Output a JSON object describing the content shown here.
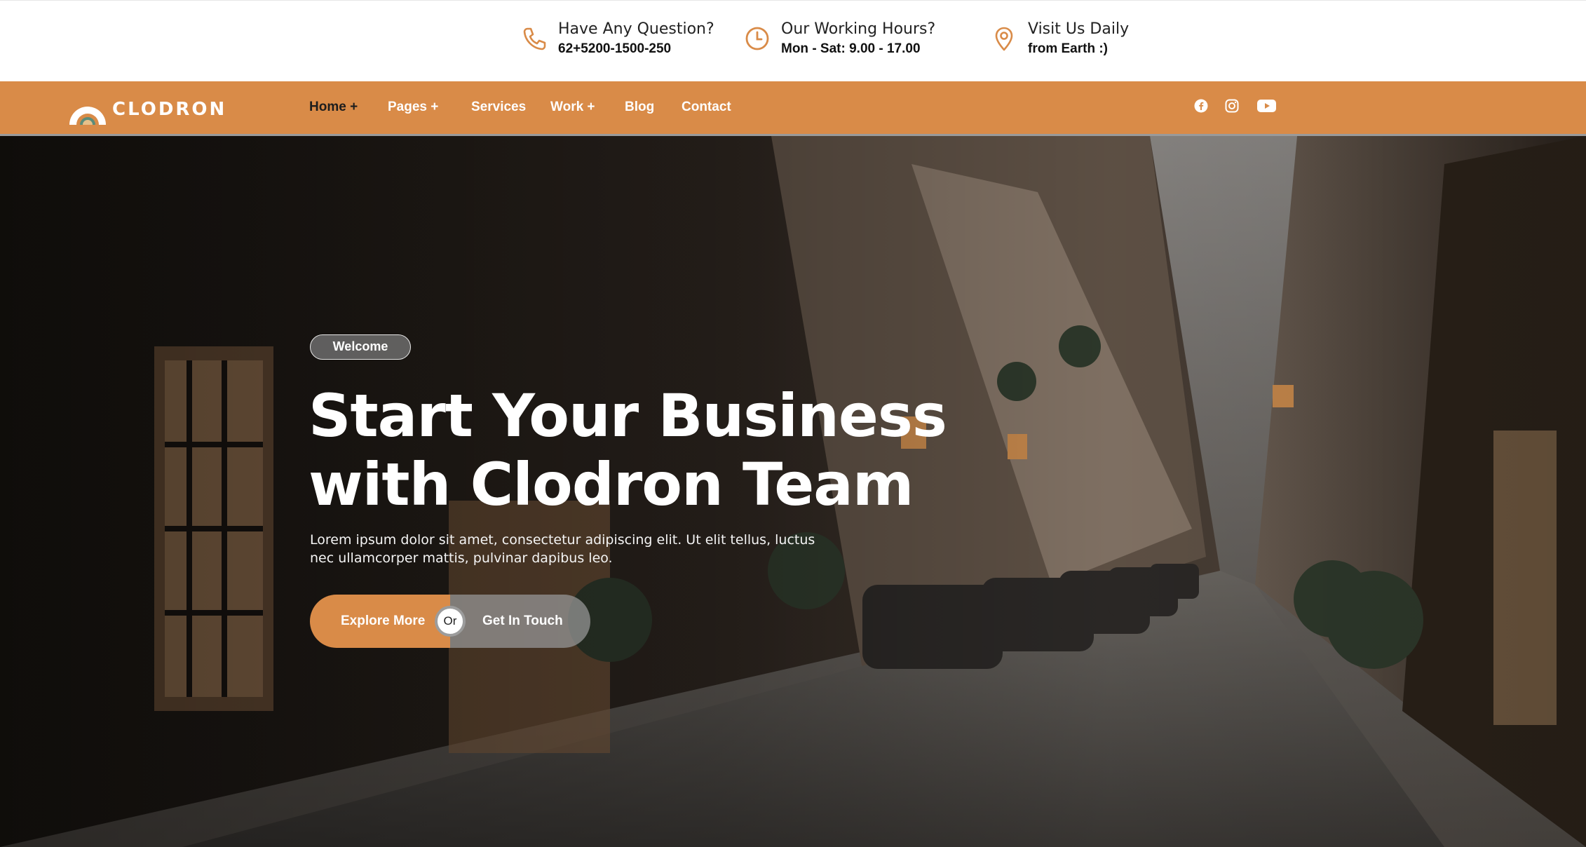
{
  "topbar": {
    "items": [
      {
        "label": "Have Any Question?",
        "value": "62+5200-1500-250",
        "icon": "phone-icon"
      },
      {
        "label": "Our Working Hours?",
        "value": "Mon - Sat: 9.00 - 17.00",
        "icon": "clock-icon"
      },
      {
        "label": "Visit Us Daily",
        "value": "from Earth :)",
        "icon": "map-pin-icon"
      }
    ]
  },
  "nav": {
    "brand": "CLODRON",
    "items": [
      {
        "label": "Home +",
        "active": true
      },
      {
        "label": "Pages +"
      },
      {
        "label": "Services"
      },
      {
        "label": "Work +"
      },
      {
        "label": "Blog"
      },
      {
        "label": "Contact"
      }
    ],
    "social": [
      "facebook-icon",
      "instagram-icon",
      "youtube-icon"
    ]
  },
  "hero": {
    "badge": "Welcome",
    "headline_line1": "Start Your Business",
    "headline_line2": "with Clodron Team",
    "para_line1": "Lorem ipsum dolor sit amet, consectetur adipiscing elit. Ut elit tellus, luctus",
    "para_line2": "nec ullamcorper mattis, pulvinar dapibus leo.",
    "primary_cta": "Explore More",
    "separator": "Or",
    "secondary_cta": "Get In Touch"
  },
  "colors": {
    "accent": "#d98b48",
    "nav_text": "#ffffff",
    "active_nav_text": "#1d1d1d"
  }
}
